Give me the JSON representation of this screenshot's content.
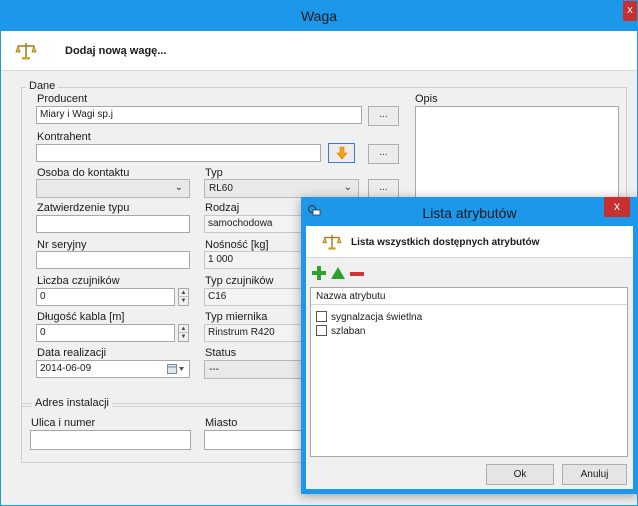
{
  "window": {
    "title": "Waga",
    "close_label": "x"
  },
  "header": {
    "title": "Dodaj nową wagę..."
  },
  "dane": {
    "legend": "Dane",
    "producent": {
      "label": "Producent",
      "value": "Miary i Wagi sp.j",
      "button": "..."
    },
    "kontrahent": {
      "label": "Kontrahent",
      "value": "",
      "button": "..."
    },
    "osoba": {
      "label": "Osoba do kontaktu",
      "value": ""
    },
    "typ": {
      "label": "Typ",
      "value": "RL60",
      "button": "..."
    },
    "zatwierdzenie": {
      "label": "Zatwierdzenie typu",
      "value": ""
    },
    "rodzaj": {
      "label": "Rodzaj",
      "value": "samochodowa"
    },
    "nr_seryjny": {
      "label": "Nr seryjny",
      "value": ""
    },
    "nosnosc": {
      "label": "Nośność [kg]",
      "value": "1 000"
    },
    "liczba_czujnikow": {
      "label": "Liczba czujników",
      "value": "0"
    },
    "typ_czujnikow": {
      "label": "Typ czujników",
      "value": "C16"
    },
    "dlugosc_kabla": {
      "label": "Długość kabla [m]",
      "value": "0"
    },
    "typ_miernika": {
      "label": "Typ miernika",
      "value": "Rinstrum R420"
    },
    "data_realizacji": {
      "label": "Data realizacji",
      "value": "2014-06-09"
    },
    "status": {
      "label": "Status",
      "value": "---"
    },
    "opis": {
      "label": "Opis",
      "value": ""
    }
  },
  "adres": {
    "legend": "Adres instalacji",
    "ulica": {
      "label": "Ulica i numer",
      "value": ""
    },
    "miasto": {
      "label": "Miasto",
      "value": ""
    }
  },
  "dialog": {
    "title": "Lista atrybutów",
    "header": "Lista wszystkich dostępnych atrybutów",
    "column": "Nazwa atrybutu",
    "items": [
      {
        "label": "sygnalzacja świetlna",
        "checked": false
      },
      {
        "label": "szlaban",
        "checked": false
      }
    ],
    "ok": "Ok",
    "cancel": "Anuluj",
    "close_label": "x"
  },
  "colors": {
    "titlebar": "#1c97ea",
    "close": "#c7302c",
    "add": "#2ea02e",
    "up": "#2ea02e",
    "remove": "#d23333",
    "arrow": "#f5a312"
  },
  "icons": [
    "scale-icon",
    "add-icon",
    "move-up-icon",
    "remove-icon",
    "arrow-down-icon",
    "calendar-icon",
    "close-icon"
  ]
}
